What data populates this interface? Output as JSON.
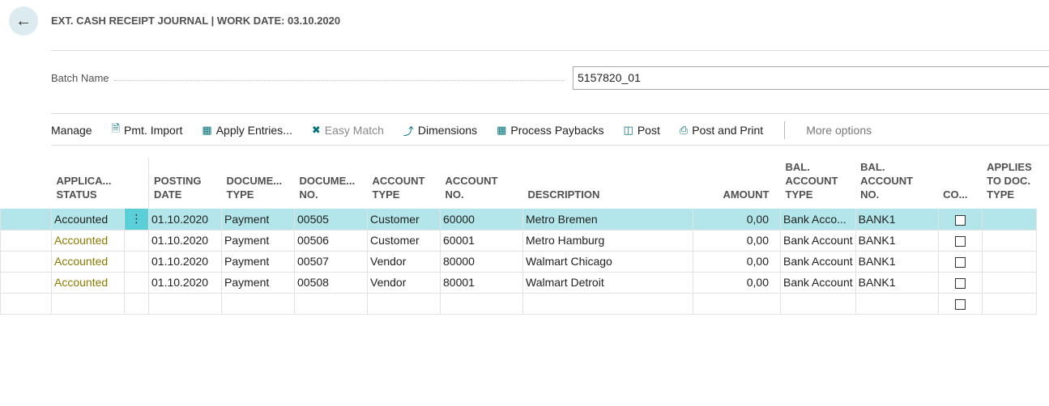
{
  "header": {
    "title": "EXT. CASH RECEIPT JOURNAL | WORK DATE: 03.10.2020"
  },
  "batch": {
    "label": "Batch Name",
    "value": "5157820_01"
  },
  "toolbar": {
    "manage": "Manage",
    "pmt_import": "Pmt. Import",
    "apply_entries": "Apply Entries...",
    "easy_match": "Easy Match",
    "dimensions": "Dimensions",
    "process_paybacks": "Process Paybacks",
    "post": "Post",
    "post_and_print": "Post and Print",
    "more_options": "More options"
  },
  "columns": {
    "status": "APPLICA... STATUS",
    "posting_date": "POSTING DATE",
    "doc_type": "DOCUME... TYPE",
    "doc_no": "DOCUME... NO.",
    "acct_type": "ACCOUNT TYPE",
    "acct_no": "ACCOUNT NO.",
    "description": "DESCRIPTION",
    "amount": "AMOUNT",
    "bal_type": "BAL. ACCOUNT TYPE",
    "bal_no": "BAL. ACCOUNT NO.",
    "co": "CO...",
    "applies": "APPLIES TO DOC. TYPE"
  },
  "rows": [
    {
      "status": "Accounted",
      "posting_date": "01.10.2020",
      "doc_type": "Payment",
      "doc_no": "00505",
      "acct_type": "Customer",
      "acct_no": "60000",
      "description": "Metro Bremen",
      "amount": "0,00",
      "bal_type": "Bank Acco...",
      "bal_no": "BANK1"
    },
    {
      "status": "Accounted",
      "posting_date": "01.10.2020",
      "doc_type": "Payment",
      "doc_no": "00506",
      "acct_type": "Customer",
      "acct_no": "60001",
      "description": "Metro Hamburg",
      "amount": "0,00",
      "bal_type": "Bank Account",
      "bal_no": "BANK1"
    },
    {
      "status": "Accounted",
      "posting_date": "01.10.2020",
      "doc_type": "Payment",
      "doc_no": "00507",
      "acct_type": "Vendor",
      "acct_no": "80000",
      "description": "Walmart Chicago",
      "amount": "0,00",
      "bal_type": "Bank Account",
      "bal_no": "BANK1"
    },
    {
      "status": "Accounted",
      "posting_date": "01.10.2020",
      "doc_type": "Payment",
      "doc_no": "00508",
      "acct_type": "Vendor",
      "acct_no": "80001",
      "description": "Walmart Detroit",
      "amount": "0,00",
      "bal_type": "Bank Account",
      "bal_no": "BANK1"
    }
  ]
}
